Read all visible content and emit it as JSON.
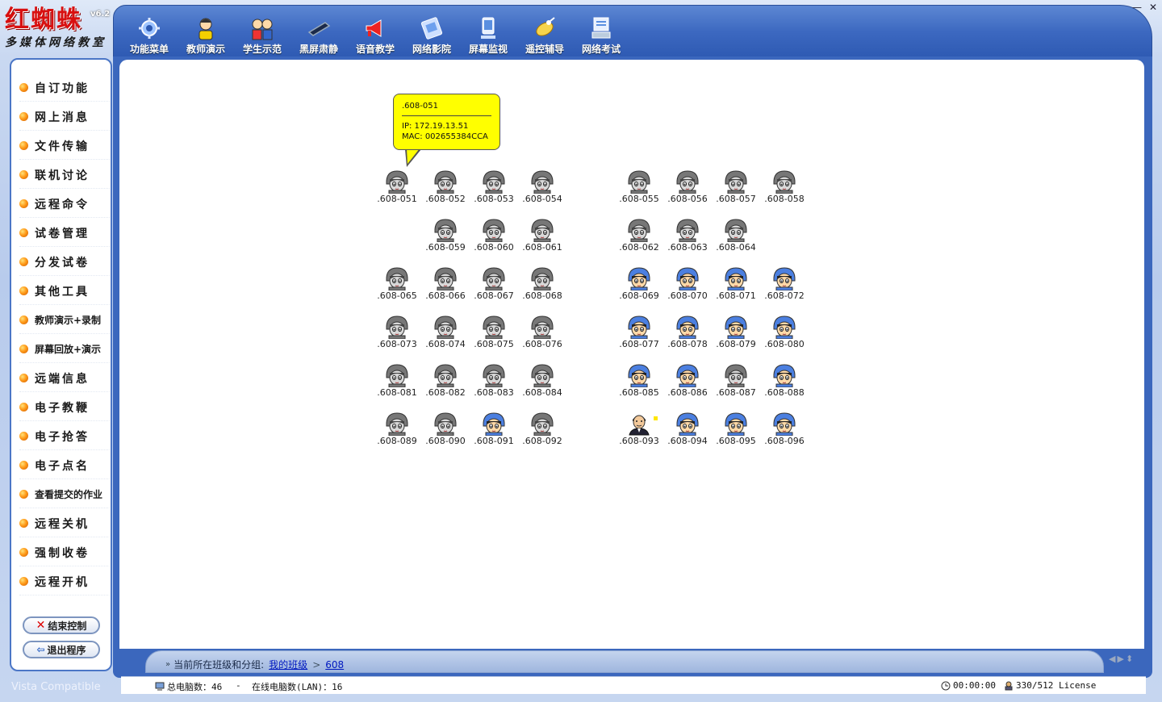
{
  "app": {
    "title": "红蜘蛛",
    "version": "v6.2",
    "subtitle": "多媒体网络教室",
    "vista_label": "Vista Compatible"
  },
  "toolbar": [
    {
      "label": "功能菜单",
      "icon": "gear-icon"
    },
    {
      "label": "教师演示",
      "icon": "teacher-icon"
    },
    {
      "label": "学生示范",
      "icon": "students-icon"
    },
    {
      "label": "黑屏肃静",
      "icon": "black-screen-icon"
    },
    {
      "label": "语音教学",
      "icon": "megaphone-icon"
    },
    {
      "label": "网络影院",
      "icon": "film-icon"
    },
    {
      "label": "屏幕监视",
      "icon": "monitor-icon"
    },
    {
      "label": "遥控辅导",
      "icon": "remote-icon"
    },
    {
      "label": "网络考试",
      "icon": "exam-icon"
    }
  ],
  "window_controls": {
    "minimize": "—",
    "close": "✕"
  },
  "sidebar": {
    "items": [
      {
        "label": "自订功能"
      },
      {
        "label": "网上消息"
      },
      {
        "label": "文件传输"
      },
      {
        "label": "联机讨论"
      },
      {
        "label": "远程命令"
      },
      {
        "label": "试卷管理"
      },
      {
        "label": "分发试卷"
      },
      {
        "label": "其他工具"
      },
      {
        "label": "教师演示+录制"
      },
      {
        "label": "屏幕回放+演示"
      },
      {
        "label": "远端信息"
      },
      {
        "label": "电子教鞭"
      },
      {
        "label": "电子抢答"
      },
      {
        "label": "电子点名"
      },
      {
        "label": "查看提交的作业"
      },
      {
        "label": "远程关机"
      },
      {
        "label": "强制收卷"
      },
      {
        "label": "远程开机"
      }
    ],
    "end_control": "结束控制",
    "exit_program": "退出程序"
  },
  "tooltip": {
    "name": ".608-051",
    "ip": "IP: 172.19.13.51",
    "mac": "MAC: 002655384CCA"
  },
  "computers": [
    {
      "name": ".608-051",
      "status": "offline"
    },
    {
      "name": ".608-052",
      "status": "offline"
    },
    {
      "name": ".608-053",
      "status": "offline"
    },
    {
      "name": ".608-054",
      "status": "offline"
    },
    {
      "name": ".608-055",
      "status": "offline"
    },
    {
      "name": ".608-056",
      "status": "offline"
    },
    {
      "name": ".608-057",
      "status": "offline"
    },
    {
      "name": ".608-058",
      "status": "offline"
    },
    {
      "name": ".608-059",
      "status": "offline"
    },
    {
      "name": ".608-060",
      "status": "offline"
    },
    {
      "name": ".608-061",
      "status": "offline"
    },
    {
      "name": ".608-062",
      "status": "offline"
    },
    {
      "name": ".608-063",
      "status": "offline"
    },
    {
      "name": ".608-064",
      "status": "offline"
    },
    {
      "name": ".608-065",
      "status": "offline"
    },
    {
      "name": ".608-066",
      "status": "offline"
    },
    {
      "name": ".608-067",
      "status": "offline"
    },
    {
      "name": ".608-068",
      "status": "offline"
    },
    {
      "name": ".608-069",
      "status": "online"
    },
    {
      "name": ".608-070",
      "status": "online"
    },
    {
      "name": ".608-071",
      "status": "online"
    },
    {
      "name": ".608-072",
      "status": "online"
    },
    {
      "name": ".608-073",
      "status": "offline"
    },
    {
      "name": ".608-074",
      "status": "offline"
    },
    {
      "name": ".608-075",
      "status": "offline"
    },
    {
      "name": ".608-076",
      "status": "offline"
    },
    {
      "name": ".608-077",
      "status": "online"
    },
    {
      "name": ".608-078",
      "status": "online"
    },
    {
      "name": ".608-079",
      "status": "online"
    },
    {
      "name": ".608-080",
      "status": "online"
    },
    {
      "name": ".608-081",
      "status": "offline"
    },
    {
      "name": ".608-082",
      "status": "offline"
    },
    {
      "name": ".608-083",
      "status": "offline"
    },
    {
      "name": ".608-084",
      "status": "offline"
    },
    {
      "name": ".608-085",
      "status": "online"
    },
    {
      "name": ".608-086",
      "status": "online"
    },
    {
      "name": ".608-087",
      "status": "offline"
    },
    {
      "name": ".608-088",
      "status": "online"
    },
    {
      "name": ".608-089",
      "status": "offline"
    },
    {
      "name": ".608-090",
      "status": "offline"
    },
    {
      "name": ".608-091",
      "status": "online"
    },
    {
      "name": ".608-092",
      "status": "offline"
    },
    {
      "name": ".608-093",
      "status": "teacher"
    },
    {
      "name": ".608-094",
      "status": "online"
    },
    {
      "name": ".608-095",
      "status": "online"
    },
    {
      "name": ".608-096",
      "status": "online"
    }
  ],
  "breadcrumb": {
    "prefix": "当前所在班级和分组:",
    "group": "我的班级",
    "sep": ">",
    "sub": "608"
  },
  "status": {
    "total": "总电脑数：46",
    "dash": "-",
    "online": "在线电脑数(LAN)：16",
    "timer": "00:00:00",
    "license": "330/512 License"
  },
  "colors": {
    "frame_blue": "#3b67bd",
    "tooltip_yellow": "#ffff00",
    "online_helmet": "#4b7fe0",
    "offline_helmet": "#777777"
  }
}
